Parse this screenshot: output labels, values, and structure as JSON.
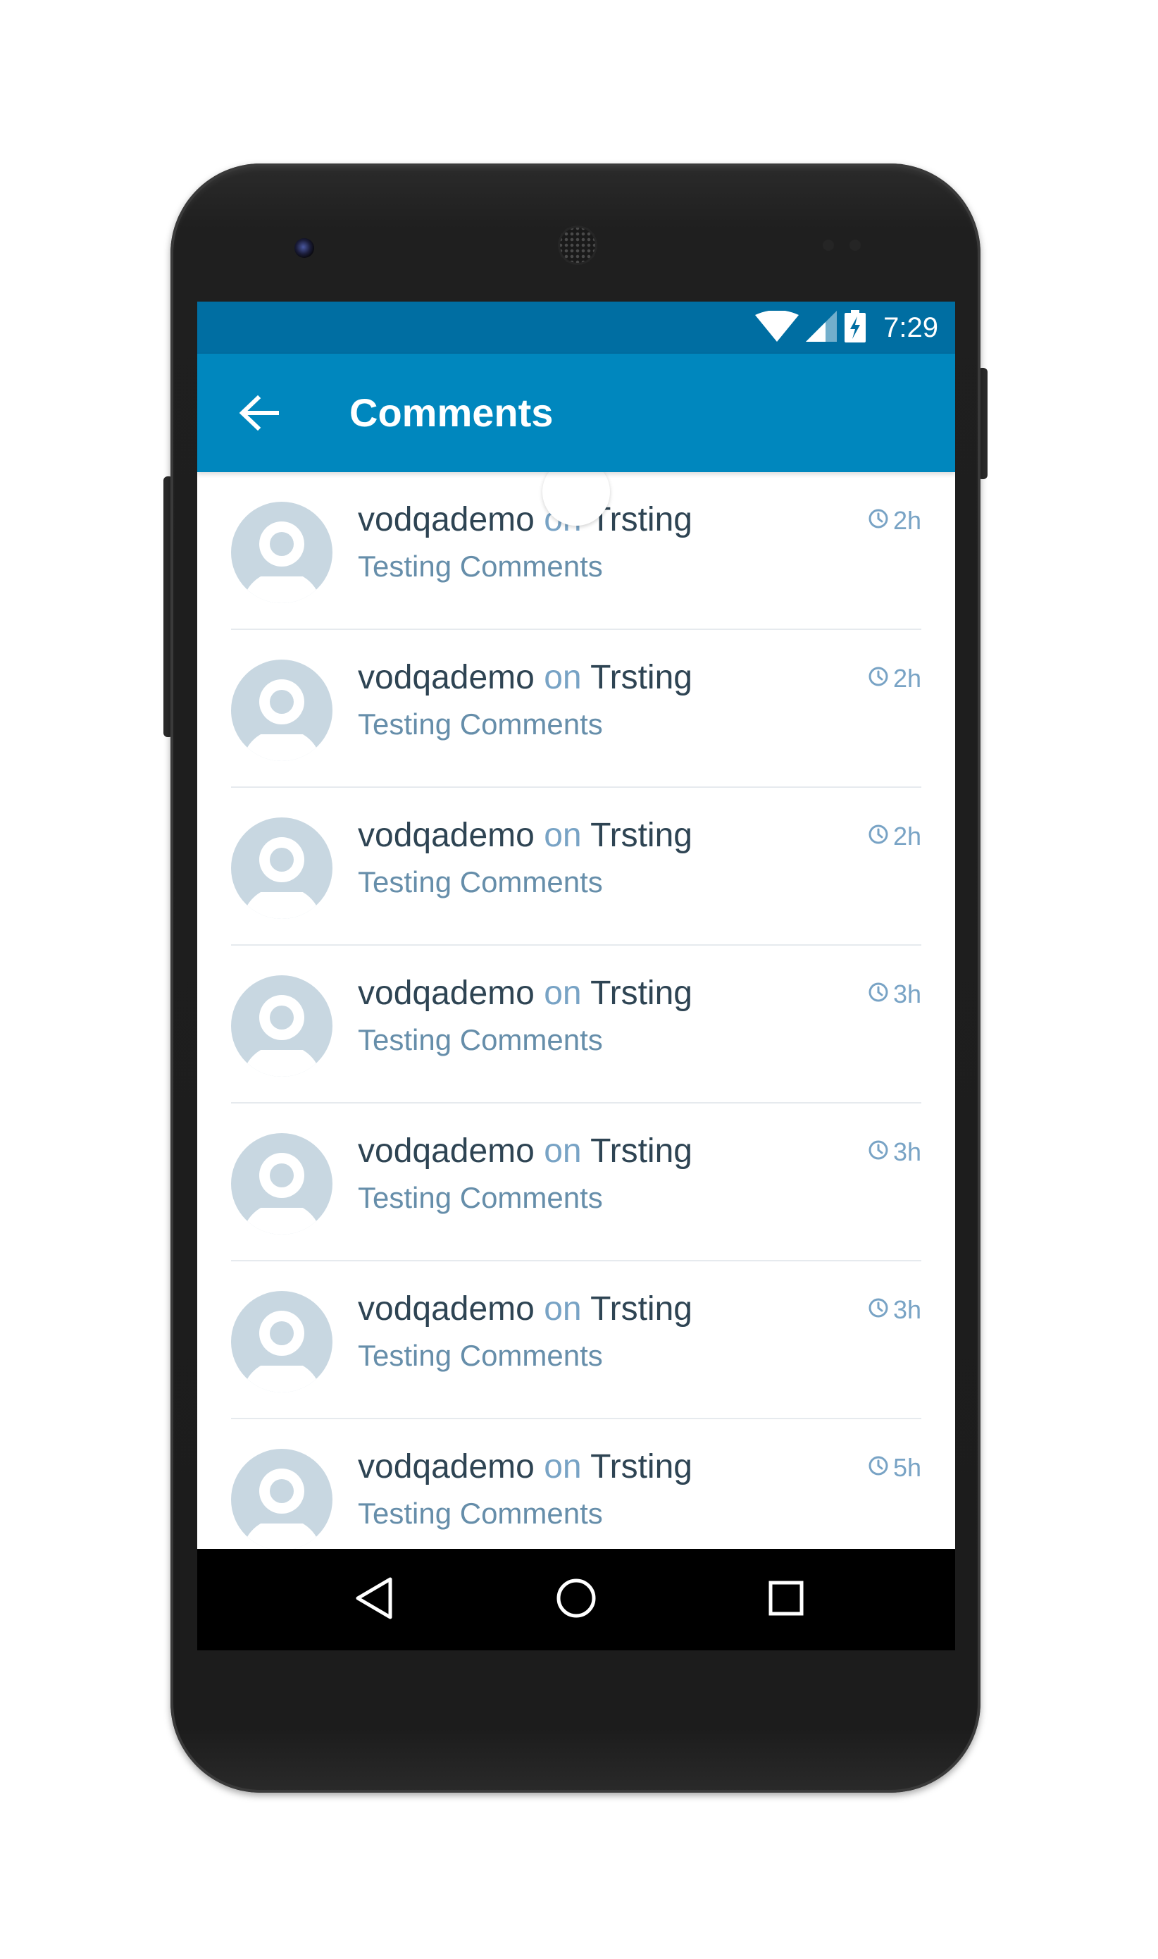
{
  "status_bar": {
    "time": "7:29",
    "icons": [
      "wifi-icon",
      "cell-signal-icon",
      "battery-charging-icon"
    ],
    "background_color": "#006ea2"
  },
  "app_bar": {
    "title": "Comments",
    "back_icon": "arrow-left-icon",
    "background_color": "#0087be"
  },
  "comments": [
    {
      "author": "vodqademo",
      "connector": "on",
      "post": "Trsting",
      "body": "Testing Comments",
      "time": "2h"
    },
    {
      "author": "vodqademo",
      "connector": "on",
      "post": "Trsting",
      "body": "Testing Comments",
      "time": "2h"
    },
    {
      "author": "vodqademo",
      "connector": "on",
      "post": "Trsting",
      "body": "Testing Comments",
      "time": "2h"
    },
    {
      "author": "vodqademo",
      "connector": "on",
      "post": "Trsting",
      "body": "Testing Comments",
      "time": "3h"
    },
    {
      "author": "vodqademo",
      "connector": "on",
      "post": "Trsting",
      "body": "Testing Comments",
      "time": "3h"
    },
    {
      "author": "vodqademo",
      "connector": "on",
      "post": "Trsting",
      "body": "Testing Comments",
      "time": "3h"
    },
    {
      "author": "vodqademo",
      "connector": "on",
      "post": "Trsting",
      "body": "Testing Comments",
      "time": "5h"
    }
  ],
  "colors": {
    "author_text": "#2e4453",
    "accent_text": "#78a3c5",
    "body_text": "#668eaa",
    "avatar_placeholder": "#c8d7e1"
  },
  "nav_bar": {
    "icons": [
      "back-triangle-icon",
      "home-circle-icon",
      "recents-square-icon"
    ]
  }
}
